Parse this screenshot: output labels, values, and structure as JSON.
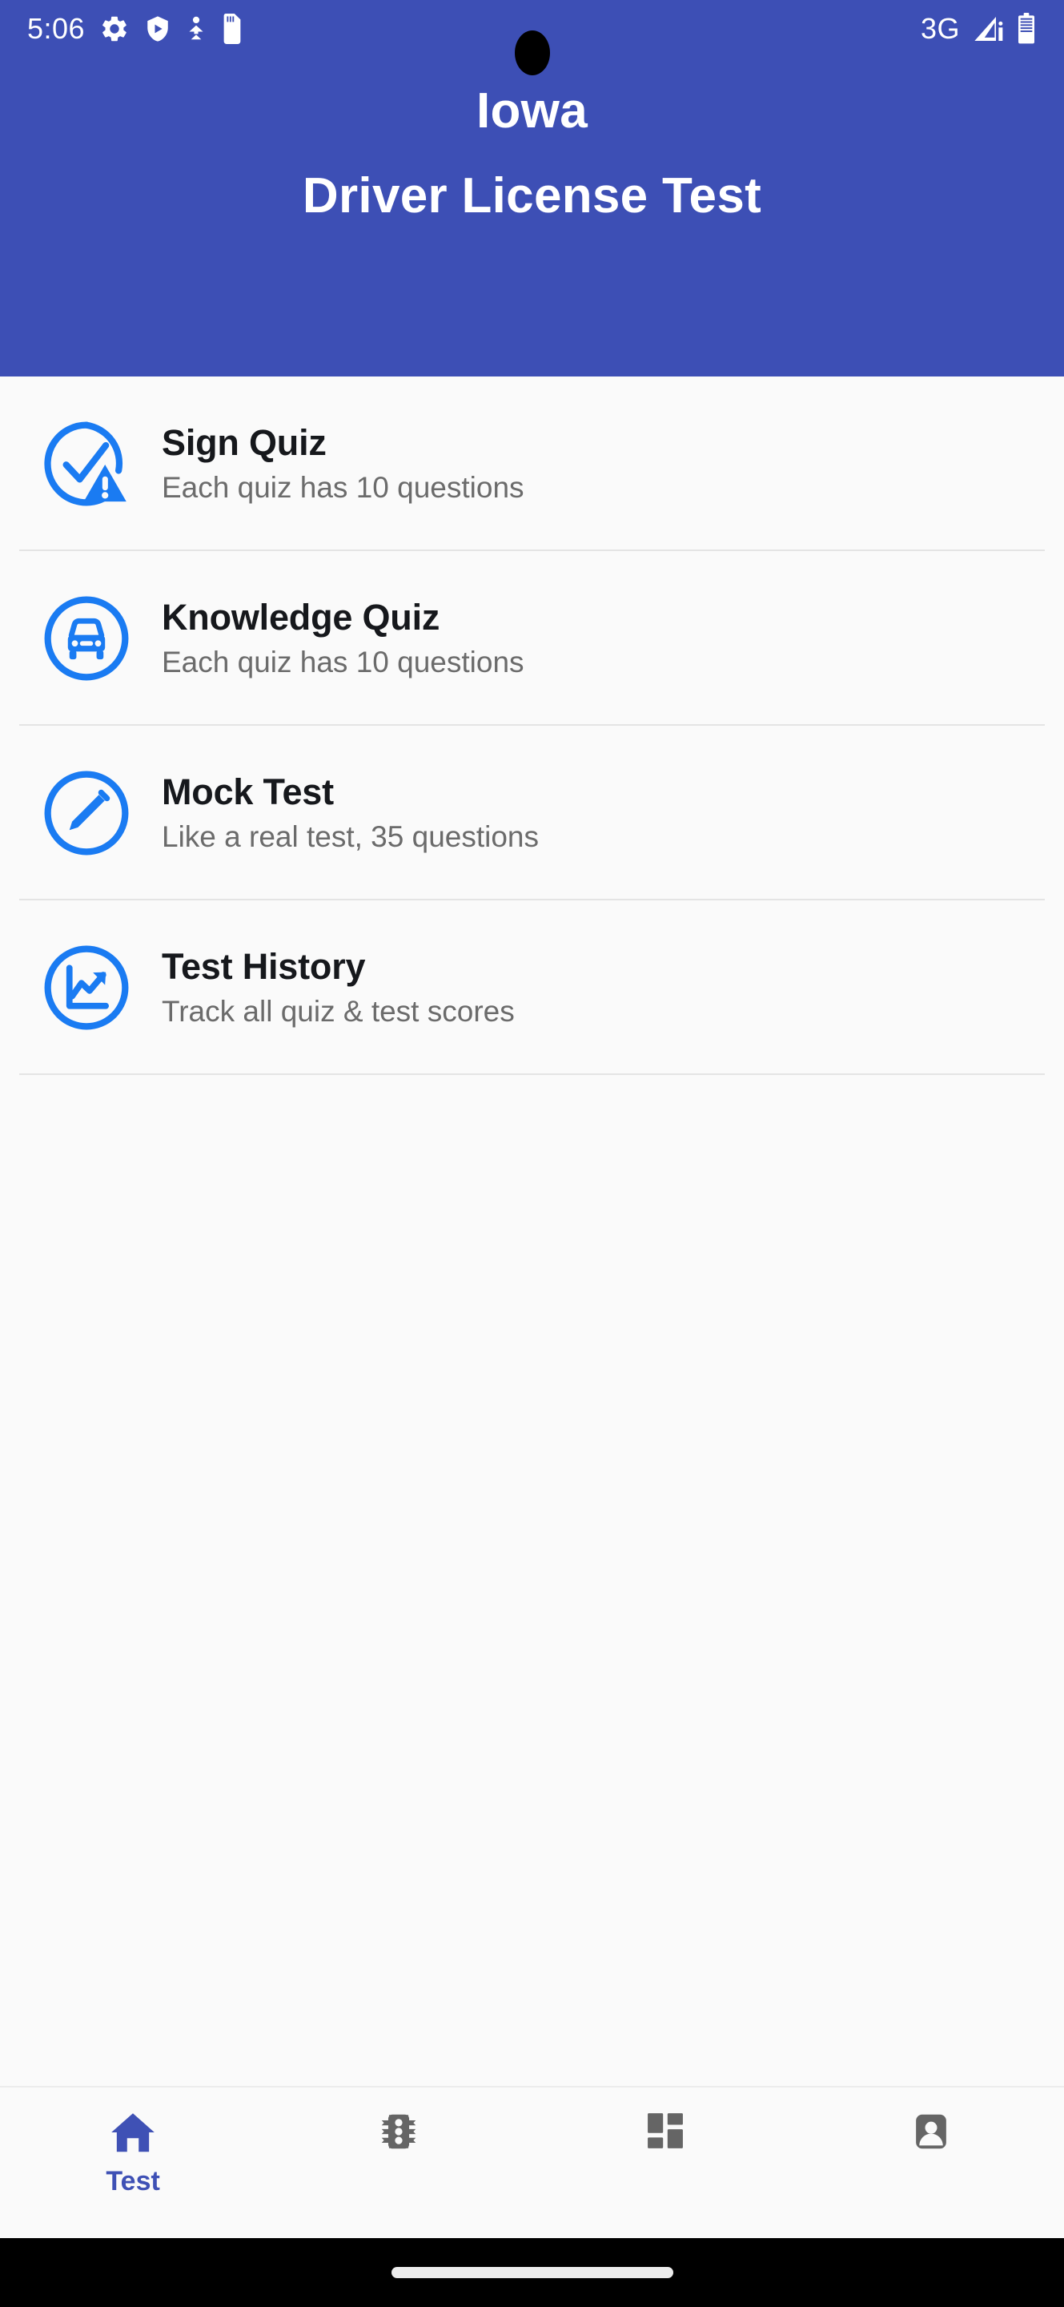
{
  "status_bar": {
    "time": "5:06",
    "network": "3G",
    "icons_left": [
      "settings-gear-icon",
      "play-protect-shield-icon",
      "download-icon",
      "sd-card-icon"
    ],
    "icons_right": [
      "signal-bars-icon",
      "battery-icon"
    ]
  },
  "header": {
    "title": "Iowa",
    "subtitle": "Driver License Test",
    "background_color": "#3d4fb5",
    "text_color": "#ffffff"
  },
  "menu": {
    "accent_color": "#1a7bf2",
    "items": [
      {
        "title": "Sign Quiz",
        "subtitle": "Each quiz has 10 questions",
        "icon": "check-circle-warning-icon"
      },
      {
        "title": "Knowledge Quiz",
        "subtitle": "Each quiz has 10 questions",
        "icon": "car-circle-icon"
      },
      {
        "title": "Mock Test",
        "subtitle": "Like a real test, 35 questions",
        "icon": "pencil-circle-icon"
      },
      {
        "title": "Test History",
        "subtitle": "Track all quiz & test scores",
        "icon": "trending-chart-circle-icon"
      }
    ]
  },
  "bottom_nav": {
    "active_color": "#3f51b5",
    "inactive_color": "#656565",
    "items": [
      {
        "label": "Test",
        "icon": "home-icon",
        "active": true
      },
      {
        "label": "",
        "icon": "traffic-light-icon",
        "active": false
      },
      {
        "label": "",
        "icon": "dashboard-grid-icon",
        "active": false
      },
      {
        "label": "",
        "icon": "account-person-icon",
        "active": false
      }
    ]
  }
}
